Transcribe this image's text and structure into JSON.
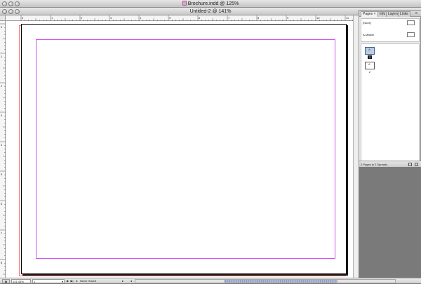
{
  "window_back": {
    "title": "Brochure.indd @ 125%"
  },
  "window_front": {
    "title": "Untitled-2 @ 141%"
  },
  "ruler": {
    "top_labels": [
      "0",
      "1",
      "2",
      "3",
      "4",
      "5",
      "6",
      "7",
      "8",
      "9",
      "10",
      "11"
    ],
    "left_labels": [
      "0",
      "1",
      "2",
      "3",
      "4",
      "5",
      "6",
      "7",
      "8"
    ]
  },
  "status_bar": {
    "zoom_value": "141.43%",
    "page_value": "1",
    "save_status": "Never Saved"
  },
  "pages_panel": {
    "tabs": [
      "Pages",
      "Info",
      "Layers",
      "Links"
    ],
    "menu_icon": "panel-menu-icon",
    "masters": [
      "[None]",
      "A-Master"
    ],
    "page_numbers": [
      "1",
      "2"
    ],
    "thumb_prefix": "A",
    "footer_text": "2 Pages in 2 Spreads"
  },
  "colors": {
    "margin_guide": "#d04cf0",
    "bleed_guide": "#ff6f6f",
    "selected_page": "#b7cde6"
  }
}
